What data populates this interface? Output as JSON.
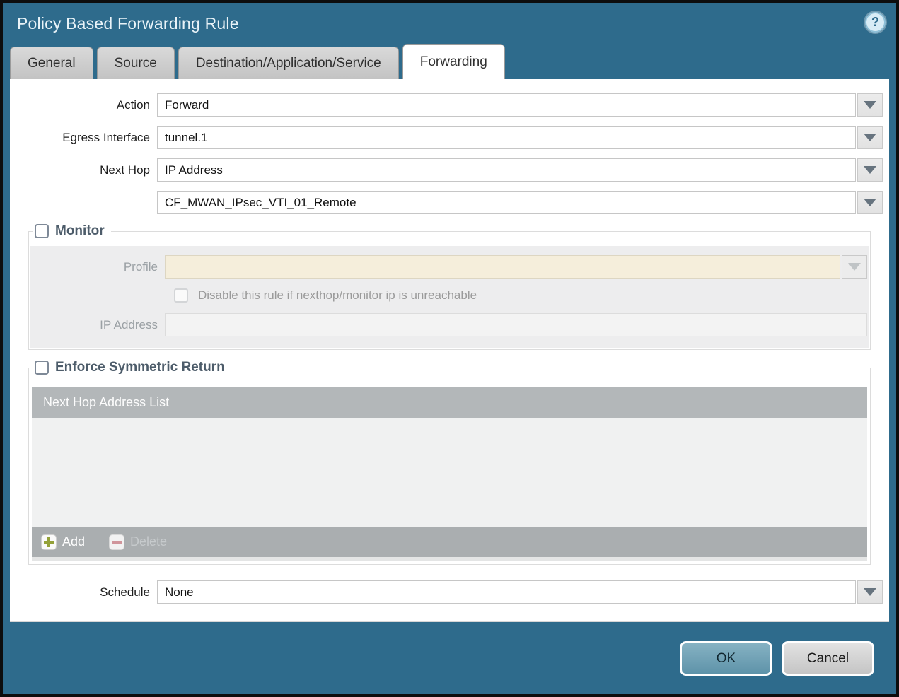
{
  "dialog": {
    "title": "Policy Based Forwarding Rule",
    "help_icon_glyph": "?"
  },
  "tabs": [
    {
      "label": "General",
      "active": false
    },
    {
      "label": "Source",
      "active": false
    },
    {
      "label": "Destination/Application/Service",
      "active": false
    },
    {
      "label": "Forwarding",
      "active": true
    }
  ],
  "form": {
    "action": {
      "label": "Action",
      "value": "Forward"
    },
    "egress_interface": {
      "label": "Egress Interface",
      "value": "tunnel.1"
    },
    "next_hop": {
      "label": "Next Hop",
      "value": "IP Address"
    },
    "next_hop_address": {
      "value": "CF_MWAN_IPsec_VTI_01_Remote"
    },
    "schedule": {
      "label": "Schedule",
      "value": "None"
    }
  },
  "monitor": {
    "legend": "Monitor",
    "checked": false,
    "profile": {
      "label": "Profile",
      "value": ""
    },
    "disable_rule": {
      "label": "Disable this rule if nexthop/monitor ip is unreachable",
      "checked": false
    },
    "ip_address": {
      "label": "IP Address",
      "value": ""
    }
  },
  "enforce_symmetric_return": {
    "legend": "Enforce Symmetric Return",
    "checked": false,
    "table": {
      "header": "Next Hop Address List",
      "rows": [],
      "add_label": "Add",
      "delete_label": "Delete"
    }
  },
  "footer": {
    "ok_label": "OK",
    "cancel_label": "Cancel"
  },
  "colors": {
    "titlebar_teal": "#2e6b8c",
    "active_tab_bg": "#ffffff",
    "disabled_profile_bg": "#f5eedb",
    "table_header_gray": "#b3b7b9",
    "ok_button_blue": "#6fa3ba",
    "add_plus_green": "#94a139",
    "delete_minus_red": "#d0959b"
  }
}
